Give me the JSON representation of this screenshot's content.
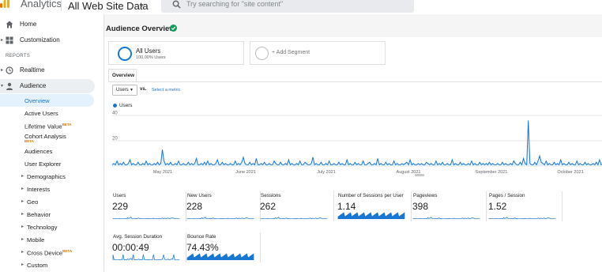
{
  "app": {
    "title": "Analytics",
    "view_name": "All Web Site Data",
    "search_placeholder": "Try searching for \"site content\""
  },
  "sidebar": {
    "top_items": [
      {
        "label": "Home",
        "icon": "home-icon"
      },
      {
        "label": "Customization",
        "icon": "grid-icon"
      }
    ],
    "section_label": "REPORTS",
    "report_items": [
      {
        "label": "Realtime",
        "icon": "clock-icon"
      },
      {
        "label": "Audience",
        "icon": "person-icon"
      }
    ],
    "audience_sub": [
      {
        "label": "Overview",
        "selected": true
      },
      {
        "label": "Active Users"
      },
      {
        "label": "Lifetime Value",
        "badge": "BETA"
      },
      {
        "label": "Cohort Analysis",
        "badge": "BETA"
      },
      {
        "label": "Audiences"
      },
      {
        "label": "User Explorer"
      },
      {
        "label": "Demographics",
        "expandable": true
      },
      {
        "label": "Interests",
        "expandable": true
      },
      {
        "label": "Geo",
        "expandable": true
      },
      {
        "label": "Behavior",
        "expandable": true
      },
      {
        "label": "Technology",
        "expandable": true
      },
      {
        "label": "Mobile",
        "expandable": true
      },
      {
        "label": "Cross Device",
        "expandable": true,
        "badge": "BETA"
      },
      {
        "label": "Custom",
        "expandable": true
      }
    ]
  },
  "main": {
    "page_title": "Audience Overview",
    "segment": {
      "title": "All Users",
      "subtitle": "100.00% Users"
    },
    "add_segment_label": "+ Add Segment",
    "tabs": [
      {
        "label": "Overview"
      }
    ],
    "metric_select": "Users",
    "vs_label": "vs.",
    "select_metric_link": "Select a metric",
    "legend_label": "Users"
  },
  "chart_data": {
    "type": "line",
    "series": [
      {
        "name": "Users",
        "values": [
          1,
          2,
          1,
          4,
          1,
          2,
          1,
          3,
          1,
          1,
          2,
          5,
          1,
          2,
          1,
          1,
          3,
          1,
          1,
          2,
          1,
          4,
          1,
          2,
          1,
          1,
          2,
          1,
          3,
          1,
          2,
          13,
          4,
          1,
          2,
          1,
          3,
          1,
          1,
          2,
          1,
          4,
          1,
          1,
          2,
          1,
          1,
          3,
          1,
          2,
          1,
          2,
          6,
          1,
          1,
          2,
          1,
          3,
          1,
          4,
          1,
          2,
          1,
          1,
          2,
          5,
          1,
          1,
          3,
          1,
          2,
          1,
          1,
          2,
          1,
          1,
          4,
          1,
          2,
          1,
          3,
          7,
          2,
          1,
          1,
          3,
          1,
          2,
          1,
          6,
          1,
          1,
          2,
          1,
          3,
          1,
          1,
          2,
          1,
          1,
          4,
          2,
          1,
          1,
          3,
          1,
          1,
          2,
          1,
          5,
          1,
          2,
          1,
          1,
          2,
          1,
          4,
          1,
          1,
          3,
          2,
          1,
          1,
          2,
          7,
          1,
          2,
          1,
          1,
          3,
          1,
          1,
          2,
          1,
          4,
          1,
          1,
          2,
          1,
          1,
          3,
          1,
          2,
          1,
          1,
          5,
          1,
          2,
          1,
          1,
          3,
          1,
          2,
          1,
          1,
          4,
          1,
          1,
          2,
          3,
          1,
          1,
          2,
          1,
          6,
          1,
          2,
          1,
          1,
          3,
          1,
          2,
          1,
          1,
          4,
          1,
          2,
          1,
          1,
          2,
          1,
          2,
          3,
          1,
          5,
          1,
          2,
          1,
          1,
          2,
          1,
          2,
          1,
          1,
          3,
          2,
          1,
          2,
          1,
          1,
          4,
          1,
          2,
          1,
          3,
          1,
          1,
          2,
          1,
          1,
          5,
          1,
          2,
          1,
          1,
          3,
          1,
          2,
          1,
          1,
          2,
          1,
          4,
          1,
          2,
          1,
          1,
          3,
          1,
          2,
          1,
          2,
          1,
          3,
          1,
          2,
          1,
          1,
          2,
          1,
          1,
          3,
          1,
          2,
          1,
          1,
          2,
          1,
          4,
          2,
          1,
          1,
          3,
          1,
          6,
          2,
          1,
          36,
          2,
          1,
          1,
          3,
          1,
          4,
          8,
          3,
          2,
          1,
          4,
          1,
          2,
          1,
          1,
          3,
          1,
          2,
          1,
          5,
          1,
          2,
          1,
          1,
          3,
          1,
          2,
          1,
          1,
          4,
          1,
          2,
          1,
          1,
          3,
          1,
          2,
          1,
          1,
          2,
          1,
          3,
          1,
          5,
          1,
          2
        ]
      }
    ],
    "x_tick_labels": [
      "May 2021",
      "June 2021",
      "July 2021",
      "August 2021",
      "September 2021",
      "October 2021"
    ],
    "y_tick_labels": [
      "40",
      "20"
    ],
    "ylim": [
      0,
      40
    ],
    "color": "#1976d2",
    "grid": true
  },
  "scorecards": [
    {
      "label": "Users",
      "value": "229"
    },
    {
      "label": "New Users",
      "value": "228"
    },
    {
      "label": "Sessions",
      "value": "262"
    },
    {
      "label": "Number of Sessions per User",
      "value": "1.14"
    },
    {
      "label": "Pageviews",
      "value": "398"
    },
    {
      "label": "Pages / Session",
      "value": "1.52"
    },
    {
      "label": "Avg. Session Duration",
      "value": "00:00:49"
    },
    {
      "label": "Bounce Rate",
      "value": "74.43%"
    }
  ],
  "colors": {
    "accent": "#1976d2",
    "logo_orange": "#f9ab00",
    "logo_dark_orange": "#e37400",
    "verified": "#0f9d58"
  }
}
